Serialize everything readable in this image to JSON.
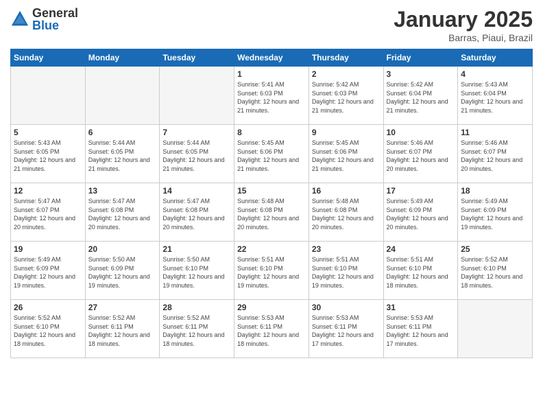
{
  "logo": {
    "general": "General",
    "blue": "Blue"
  },
  "header": {
    "title": "January 2025",
    "subtitle": "Barras, Piaui, Brazil"
  },
  "weekdays": [
    "Sunday",
    "Monday",
    "Tuesday",
    "Wednesday",
    "Thursday",
    "Friday",
    "Saturday"
  ],
  "weeks": [
    [
      {
        "day": "",
        "empty": true
      },
      {
        "day": "",
        "empty": true
      },
      {
        "day": "",
        "empty": true
      },
      {
        "day": "1",
        "sunrise": "Sunrise: 5:41 AM",
        "sunset": "Sunset: 6:03 PM",
        "daylight": "Daylight: 12 hours and 21 minutes."
      },
      {
        "day": "2",
        "sunrise": "Sunrise: 5:42 AM",
        "sunset": "Sunset: 6:03 PM",
        "daylight": "Daylight: 12 hours and 21 minutes."
      },
      {
        "day": "3",
        "sunrise": "Sunrise: 5:42 AM",
        "sunset": "Sunset: 6:04 PM",
        "daylight": "Daylight: 12 hours and 21 minutes."
      },
      {
        "day": "4",
        "sunrise": "Sunrise: 5:43 AM",
        "sunset": "Sunset: 6:04 PM",
        "daylight": "Daylight: 12 hours and 21 minutes."
      }
    ],
    [
      {
        "day": "5",
        "sunrise": "Sunrise: 5:43 AM",
        "sunset": "Sunset: 6:05 PM",
        "daylight": "Daylight: 12 hours and 21 minutes."
      },
      {
        "day": "6",
        "sunrise": "Sunrise: 5:44 AM",
        "sunset": "Sunset: 6:05 PM",
        "daylight": "Daylight: 12 hours and 21 minutes."
      },
      {
        "day": "7",
        "sunrise": "Sunrise: 5:44 AM",
        "sunset": "Sunset: 6:05 PM",
        "daylight": "Daylight: 12 hours and 21 minutes."
      },
      {
        "day": "8",
        "sunrise": "Sunrise: 5:45 AM",
        "sunset": "Sunset: 6:06 PM",
        "daylight": "Daylight: 12 hours and 21 minutes."
      },
      {
        "day": "9",
        "sunrise": "Sunrise: 5:45 AM",
        "sunset": "Sunset: 6:06 PM",
        "daylight": "Daylight: 12 hours and 21 minutes."
      },
      {
        "day": "10",
        "sunrise": "Sunrise: 5:46 AM",
        "sunset": "Sunset: 6:07 PM",
        "daylight": "Daylight: 12 hours and 20 minutes."
      },
      {
        "day": "11",
        "sunrise": "Sunrise: 5:46 AM",
        "sunset": "Sunset: 6:07 PM",
        "daylight": "Daylight: 12 hours and 20 minutes."
      }
    ],
    [
      {
        "day": "12",
        "sunrise": "Sunrise: 5:47 AM",
        "sunset": "Sunset: 6:07 PM",
        "daylight": "Daylight: 12 hours and 20 minutes."
      },
      {
        "day": "13",
        "sunrise": "Sunrise: 5:47 AM",
        "sunset": "Sunset: 6:08 PM",
        "daylight": "Daylight: 12 hours and 20 minutes."
      },
      {
        "day": "14",
        "sunrise": "Sunrise: 5:47 AM",
        "sunset": "Sunset: 6:08 PM",
        "daylight": "Daylight: 12 hours and 20 minutes."
      },
      {
        "day": "15",
        "sunrise": "Sunrise: 5:48 AM",
        "sunset": "Sunset: 6:08 PM",
        "daylight": "Daylight: 12 hours and 20 minutes."
      },
      {
        "day": "16",
        "sunrise": "Sunrise: 5:48 AM",
        "sunset": "Sunset: 6:08 PM",
        "daylight": "Daylight: 12 hours and 20 minutes."
      },
      {
        "day": "17",
        "sunrise": "Sunrise: 5:49 AM",
        "sunset": "Sunset: 6:09 PM",
        "daylight": "Daylight: 12 hours and 20 minutes."
      },
      {
        "day": "18",
        "sunrise": "Sunrise: 5:49 AM",
        "sunset": "Sunset: 6:09 PM",
        "daylight": "Daylight: 12 hours and 19 minutes."
      }
    ],
    [
      {
        "day": "19",
        "sunrise": "Sunrise: 5:49 AM",
        "sunset": "Sunset: 6:09 PM",
        "daylight": "Daylight: 12 hours and 19 minutes."
      },
      {
        "day": "20",
        "sunrise": "Sunrise: 5:50 AM",
        "sunset": "Sunset: 6:09 PM",
        "daylight": "Daylight: 12 hours and 19 minutes."
      },
      {
        "day": "21",
        "sunrise": "Sunrise: 5:50 AM",
        "sunset": "Sunset: 6:10 PM",
        "daylight": "Daylight: 12 hours and 19 minutes."
      },
      {
        "day": "22",
        "sunrise": "Sunrise: 5:51 AM",
        "sunset": "Sunset: 6:10 PM",
        "daylight": "Daylight: 12 hours and 19 minutes."
      },
      {
        "day": "23",
        "sunrise": "Sunrise: 5:51 AM",
        "sunset": "Sunset: 6:10 PM",
        "daylight": "Daylight: 12 hours and 19 minutes."
      },
      {
        "day": "24",
        "sunrise": "Sunrise: 5:51 AM",
        "sunset": "Sunset: 6:10 PM",
        "daylight": "Daylight: 12 hours and 18 minutes."
      },
      {
        "day": "25",
        "sunrise": "Sunrise: 5:52 AM",
        "sunset": "Sunset: 6:10 PM",
        "daylight": "Daylight: 12 hours and 18 minutes."
      }
    ],
    [
      {
        "day": "26",
        "sunrise": "Sunrise: 5:52 AM",
        "sunset": "Sunset: 6:10 PM",
        "daylight": "Daylight: 12 hours and 18 minutes."
      },
      {
        "day": "27",
        "sunrise": "Sunrise: 5:52 AM",
        "sunset": "Sunset: 6:11 PM",
        "daylight": "Daylight: 12 hours and 18 minutes."
      },
      {
        "day": "28",
        "sunrise": "Sunrise: 5:52 AM",
        "sunset": "Sunset: 6:11 PM",
        "daylight": "Daylight: 12 hours and 18 minutes."
      },
      {
        "day": "29",
        "sunrise": "Sunrise: 5:53 AM",
        "sunset": "Sunset: 6:11 PM",
        "daylight": "Daylight: 12 hours and 18 minutes."
      },
      {
        "day": "30",
        "sunrise": "Sunrise: 5:53 AM",
        "sunset": "Sunset: 6:11 PM",
        "daylight": "Daylight: 12 hours and 17 minutes."
      },
      {
        "day": "31",
        "sunrise": "Sunrise: 5:53 AM",
        "sunset": "Sunset: 6:11 PM",
        "daylight": "Daylight: 12 hours and 17 minutes."
      },
      {
        "day": "",
        "empty": true
      }
    ]
  ]
}
